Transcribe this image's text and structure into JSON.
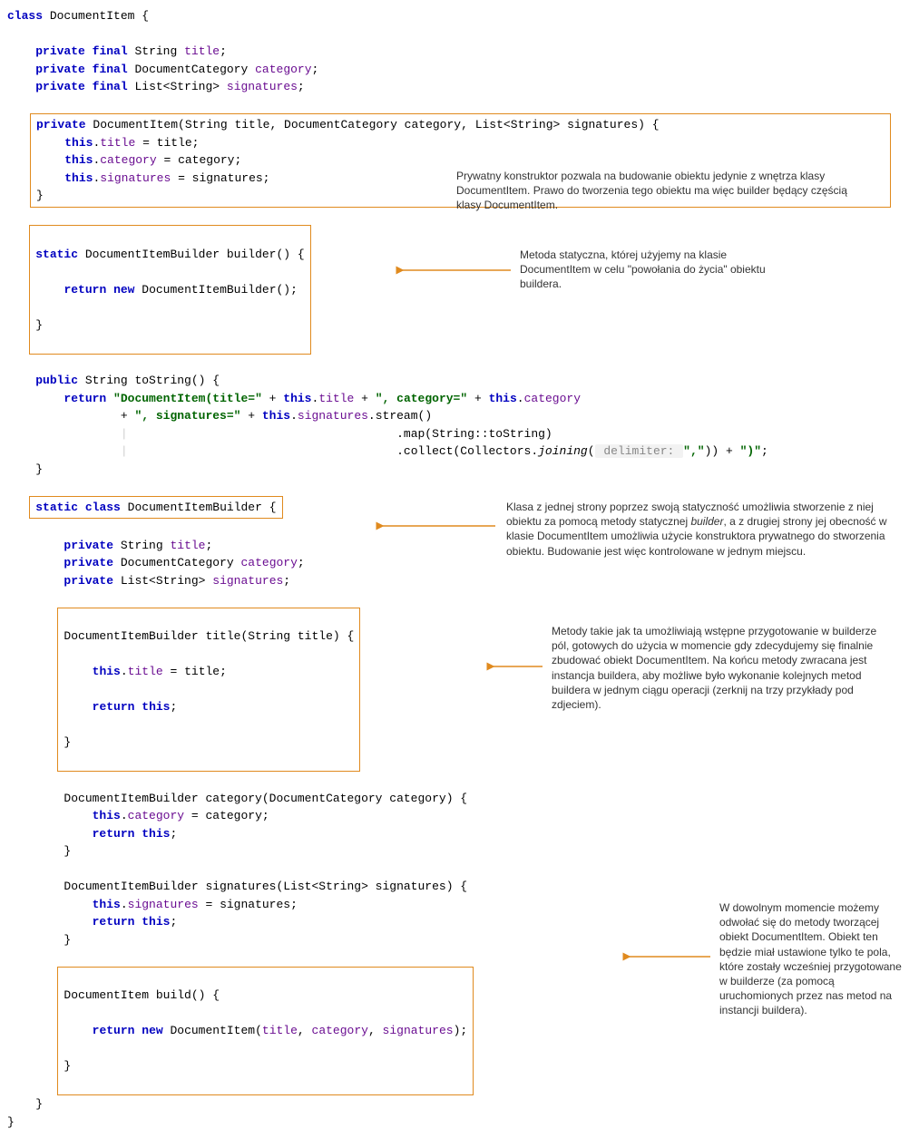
{
  "code": {
    "class_decl": {
      "kw_class": "class",
      "name": "DocumentItem",
      "brace": " {"
    },
    "fields": {
      "f1": {
        "kw_private": "private",
        "kw_final": "final",
        "type": "String",
        "name": "title",
        "semi": ";"
      },
      "f2": {
        "kw_private": "private",
        "kw_final": "final",
        "type": "DocumentCategory",
        "name": "category",
        "semi": ";"
      },
      "f3": {
        "kw_private": "private",
        "kw_final": "final",
        "type": "List<String>",
        "name": "signatures",
        "semi": ";"
      }
    },
    "ctor": {
      "kw_private": "private",
      "sig": "DocumentItem(String title, DocumentCategory category, List<String> signatures) {",
      "l1_this": "this",
      "l1_dot": ".",
      "l1_fld": "title",
      "l1_rest": " = title;",
      "l2_this": "this",
      "l2_dot": ".",
      "l2_fld": "category",
      "l2_rest": " = category;",
      "l3_this": "this",
      "l3_dot": ".",
      "l3_fld": "signatures",
      "l3_rest": " = signatures;",
      "close": "}"
    },
    "builder_method": {
      "kw_static": "static",
      "sig": "DocumentItemBuilder builder() {",
      "kw_return": "return",
      "kw_new": "new",
      "rest": " DocumentItemBuilder();",
      "close": "}"
    },
    "tostring": {
      "kw_public": "public",
      "sig": "String toString() {",
      "kw_return": "return",
      "s1": "\"DocumentItem(title=\"",
      "plus1": " + ",
      "kw_this1": "this",
      "dot1": ".",
      "fld1": "title",
      "plus2": " + ",
      "s2": "\", category=\"",
      "plus3": " + ",
      "kw_this2": "this",
      "dot2": ".",
      "fld2": "category",
      "line2_plus": "+ ",
      "s3": "\", signatures=\"",
      "plus4": " + ",
      "kw_this3": "this",
      "dot3": ".",
      "fld3": "signatures",
      "stream": ".stream()",
      "map": ".map(String::toString)",
      "collect_pre": ".collect(Collectors.",
      "collect_joining": "joining",
      "collect_open": "(",
      "hint_label": " delimiter: ",
      "s4": "\",\"",
      "collect_close": ")) + ",
      "s5": "\")\"",
      "semi": ";",
      "close": "}"
    },
    "builder_class": {
      "kw_static": "static",
      "kw_class": "class",
      "name": "DocumentItemBuilder",
      "brace": " {",
      "bf1": {
        "kw_private": "private",
        "type": "String",
        "name": "title",
        "semi": ";"
      },
      "bf2": {
        "kw_private": "private",
        "type": "DocumentCategory",
        "name": "category",
        "semi": ";"
      },
      "bf3": {
        "kw_private": "private",
        "type": "List<String>",
        "name": "signatures",
        "semi": ";"
      },
      "m_title": {
        "sig": "DocumentItemBuilder title(String title) {",
        "kw_this": "this",
        "dot": ".",
        "fld": "title",
        "rest": " = title;",
        "kw_return": "return",
        "kw_this2": "this",
        "semi": ";",
        "close": "}"
      },
      "m_category": {
        "sig": "DocumentItemBuilder category(DocumentCategory category) {",
        "kw_this": "this",
        "dot": ".",
        "fld": "category",
        "rest": " = category;",
        "kw_return": "return",
        "kw_this2": "this",
        "semi": ";",
        "close": "}"
      },
      "m_signatures": {
        "sig": "DocumentItemBuilder signatures(List<String> signatures) {",
        "kw_this": "this",
        "dot": ".",
        "fld": "signatures",
        "rest": " = signatures;",
        "kw_return": "return",
        "kw_this2": "this",
        "semi": ";",
        "close": "}"
      },
      "m_build": {
        "sig": "DocumentItem build() {",
        "kw_return": "return",
        "kw_new": "new",
        "call": " DocumentItem(",
        "a1": "title",
        "c1": ", ",
        "a2": "category",
        "c2": ", ",
        "a3": "signatures",
        "close_call": ");",
        "close": "}"
      },
      "close": "}"
    },
    "close": "}"
  },
  "annotations": {
    "a1": "Prywatny konstruktor pozwala na budowanie obiektu jedynie z wnętrza klasy DocumentItem. Prawo do tworzenia tego obiektu ma więc builder będący częścią klasy DocumentItem.",
    "a2": "Metoda statyczna, której użyjemy na klasie DocumentItem w celu \"powołania do życia\" obiektu buildera.",
    "a3_p1": "Klasa z jednej strony poprzez swoją statyczność umożliwia stworzenie z niej obiektu za pomocą metody statycznej ",
    "a3_em": "builder",
    "a3_p2": ", a z drugiej strony jej obecność w klasie DocumentItem umożliwia użycie konstruktora prywatnego do stworzenia obiektu. Budowanie jest więc kontrolowane w jednym miejscu.",
    "a4": "Metody takie jak ta umożliwiają wstępne przygotowanie w builderze pól, gotowych do użycia w momencie gdy zdecydujemy się finalnie zbudować obiekt DocumentItem. Na końcu metody zwracana jest instancja buildera, aby możliwe było wykonanie kolejnych metod buildera w jednym ciągu operacji (zerknij na trzy przykłady pod zdjeciem).",
    "a5": "W dowolnym momencie możemy odwołać się do metody tworzącej obiekt DocumentItem. Obiekt ten będzie miał ustawione tylko te pola, które zostały wcześniej przygotowane w builderze (za pomocą uruchomionych przez nas metod na instancji buildera)."
  }
}
